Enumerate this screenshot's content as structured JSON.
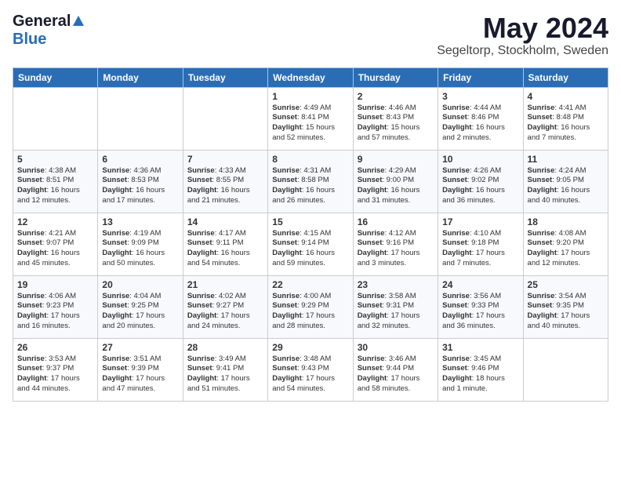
{
  "header": {
    "logo_general": "General",
    "logo_blue": "Blue",
    "month": "May 2024",
    "location": "Segeltorp, Stockholm, Sweden"
  },
  "days_of_week": [
    "Sunday",
    "Monday",
    "Tuesday",
    "Wednesday",
    "Thursday",
    "Friday",
    "Saturday"
  ],
  "weeks": [
    [
      {
        "day": "",
        "content": ""
      },
      {
        "day": "",
        "content": ""
      },
      {
        "day": "",
        "content": ""
      },
      {
        "day": "1",
        "content": "Sunrise: 4:49 AM\nSunset: 8:41 PM\nDaylight: 15 hours and 52 minutes."
      },
      {
        "day": "2",
        "content": "Sunrise: 4:46 AM\nSunset: 8:43 PM\nDaylight: 15 hours and 57 minutes."
      },
      {
        "day": "3",
        "content": "Sunrise: 4:44 AM\nSunset: 8:46 PM\nDaylight: 16 hours and 2 minutes."
      },
      {
        "day": "4",
        "content": "Sunrise: 4:41 AM\nSunset: 8:48 PM\nDaylight: 16 hours and 7 minutes."
      }
    ],
    [
      {
        "day": "5",
        "content": "Sunrise: 4:38 AM\nSunset: 8:51 PM\nDaylight: 16 hours and 12 minutes."
      },
      {
        "day": "6",
        "content": "Sunrise: 4:36 AM\nSunset: 8:53 PM\nDaylight: 16 hours and 17 minutes."
      },
      {
        "day": "7",
        "content": "Sunrise: 4:33 AM\nSunset: 8:55 PM\nDaylight: 16 hours and 21 minutes."
      },
      {
        "day": "8",
        "content": "Sunrise: 4:31 AM\nSunset: 8:58 PM\nDaylight: 16 hours and 26 minutes."
      },
      {
        "day": "9",
        "content": "Sunrise: 4:29 AM\nSunset: 9:00 PM\nDaylight: 16 hours and 31 minutes."
      },
      {
        "day": "10",
        "content": "Sunrise: 4:26 AM\nSunset: 9:02 PM\nDaylight: 16 hours and 36 minutes."
      },
      {
        "day": "11",
        "content": "Sunrise: 4:24 AM\nSunset: 9:05 PM\nDaylight: 16 hours and 40 minutes."
      }
    ],
    [
      {
        "day": "12",
        "content": "Sunrise: 4:21 AM\nSunset: 9:07 PM\nDaylight: 16 hours and 45 minutes."
      },
      {
        "day": "13",
        "content": "Sunrise: 4:19 AM\nSunset: 9:09 PM\nDaylight: 16 hours and 50 minutes."
      },
      {
        "day": "14",
        "content": "Sunrise: 4:17 AM\nSunset: 9:11 PM\nDaylight: 16 hours and 54 minutes."
      },
      {
        "day": "15",
        "content": "Sunrise: 4:15 AM\nSunset: 9:14 PM\nDaylight: 16 hours and 59 minutes."
      },
      {
        "day": "16",
        "content": "Sunrise: 4:12 AM\nSunset: 9:16 PM\nDaylight: 17 hours and 3 minutes."
      },
      {
        "day": "17",
        "content": "Sunrise: 4:10 AM\nSunset: 9:18 PM\nDaylight: 17 hours and 7 minutes."
      },
      {
        "day": "18",
        "content": "Sunrise: 4:08 AM\nSunset: 9:20 PM\nDaylight: 17 hours and 12 minutes."
      }
    ],
    [
      {
        "day": "19",
        "content": "Sunrise: 4:06 AM\nSunset: 9:23 PM\nDaylight: 17 hours and 16 minutes."
      },
      {
        "day": "20",
        "content": "Sunrise: 4:04 AM\nSunset: 9:25 PM\nDaylight: 17 hours and 20 minutes."
      },
      {
        "day": "21",
        "content": "Sunrise: 4:02 AM\nSunset: 9:27 PM\nDaylight: 17 hours and 24 minutes."
      },
      {
        "day": "22",
        "content": "Sunrise: 4:00 AM\nSunset: 9:29 PM\nDaylight: 17 hours and 28 minutes."
      },
      {
        "day": "23",
        "content": "Sunrise: 3:58 AM\nSunset: 9:31 PM\nDaylight: 17 hours and 32 minutes."
      },
      {
        "day": "24",
        "content": "Sunrise: 3:56 AM\nSunset: 9:33 PM\nDaylight: 17 hours and 36 minutes."
      },
      {
        "day": "25",
        "content": "Sunrise: 3:54 AM\nSunset: 9:35 PM\nDaylight: 17 hours and 40 minutes."
      }
    ],
    [
      {
        "day": "26",
        "content": "Sunrise: 3:53 AM\nSunset: 9:37 PM\nDaylight: 17 hours and 44 minutes."
      },
      {
        "day": "27",
        "content": "Sunrise: 3:51 AM\nSunset: 9:39 PM\nDaylight: 17 hours and 47 minutes."
      },
      {
        "day": "28",
        "content": "Sunrise: 3:49 AM\nSunset: 9:41 PM\nDaylight: 17 hours and 51 minutes."
      },
      {
        "day": "29",
        "content": "Sunrise: 3:48 AM\nSunset: 9:43 PM\nDaylight: 17 hours and 54 minutes."
      },
      {
        "day": "30",
        "content": "Sunrise: 3:46 AM\nSunset: 9:44 PM\nDaylight: 17 hours and 58 minutes."
      },
      {
        "day": "31",
        "content": "Sunrise: 3:45 AM\nSunset: 9:46 PM\nDaylight: 18 hours and 1 minute."
      },
      {
        "day": "",
        "content": ""
      }
    ]
  ]
}
